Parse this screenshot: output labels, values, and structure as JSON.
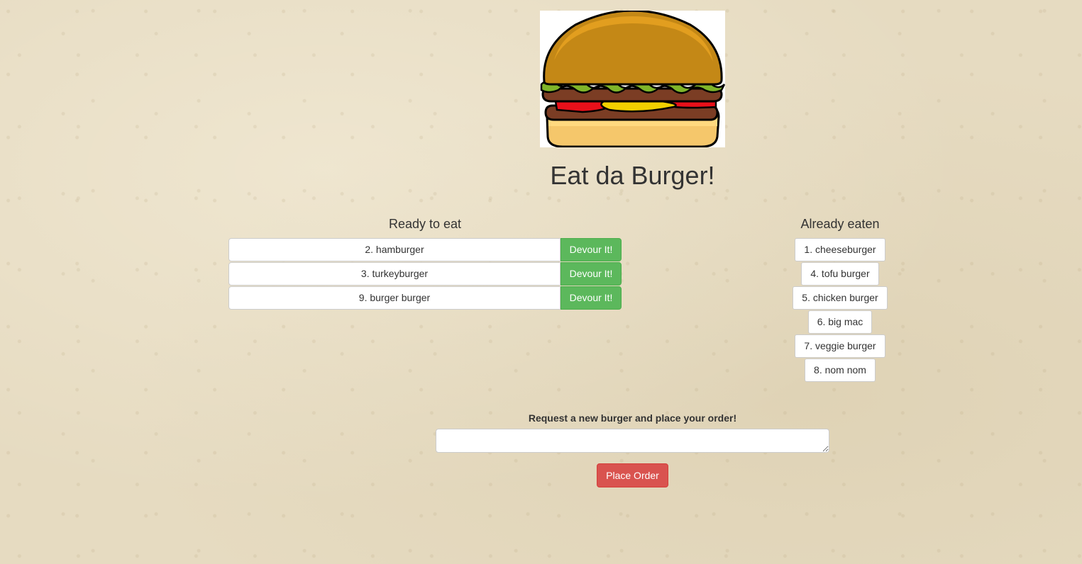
{
  "header": {
    "logo_icon": "hamburger-icon",
    "title": "Eat da Burger!"
  },
  "ready": {
    "heading": "Ready to eat",
    "items": [
      {
        "label": "2. hamburger",
        "action": "Devour It!"
      },
      {
        "label": "3. turkeyburger",
        "action": "Devour It!"
      },
      {
        "label": "9. burger burger",
        "action": "Devour It!"
      }
    ]
  },
  "eaten": {
    "heading": "Already eaten",
    "items": [
      "1. cheeseburger",
      "4. tofu burger",
      "5. chicken burger",
      "6. big mac",
      "7. veggie burger",
      "8. nom nom"
    ]
  },
  "order": {
    "label": "Request a new burger and place your order!",
    "input_value": "",
    "button": "Place Order"
  },
  "colors": {
    "background": "#e6dbc1",
    "devour_button": "#5cb85c",
    "place_order_button": "#d9534f"
  }
}
